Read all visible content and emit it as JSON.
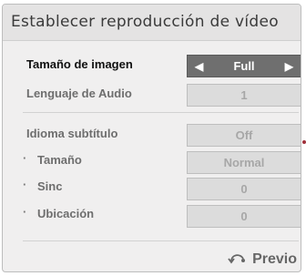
{
  "dialog": {
    "title": "Establecer reproducción de vídeo"
  },
  "settings": [
    {
      "label": "Tamaño de imagen",
      "value": "Full"
    },
    {
      "label": "Lenguaje de Audio",
      "value": "1"
    },
    {
      "label": "Idioma subtítulo",
      "value": "Off"
    },
    {
      "label": "Tamaño",
      "value": "Normal"
    },
    {
      "label": "Sinc",
      "value": "0"
    },
    {
      "label": "Ubicación",
      "value": "0"
    }
  ],
  "bullet_char": "·",
  "arrows": {
    "left": "◀",
    "right": "▶"
  },
  "footer": {
    "back_label": "Previo",
    "back_icon": "back-arrow-icon"
  },
  "colors": {
    "selected_value_bg": "#6f6f6f",
    "indicator_dot": "#a0303a"
  }
}
